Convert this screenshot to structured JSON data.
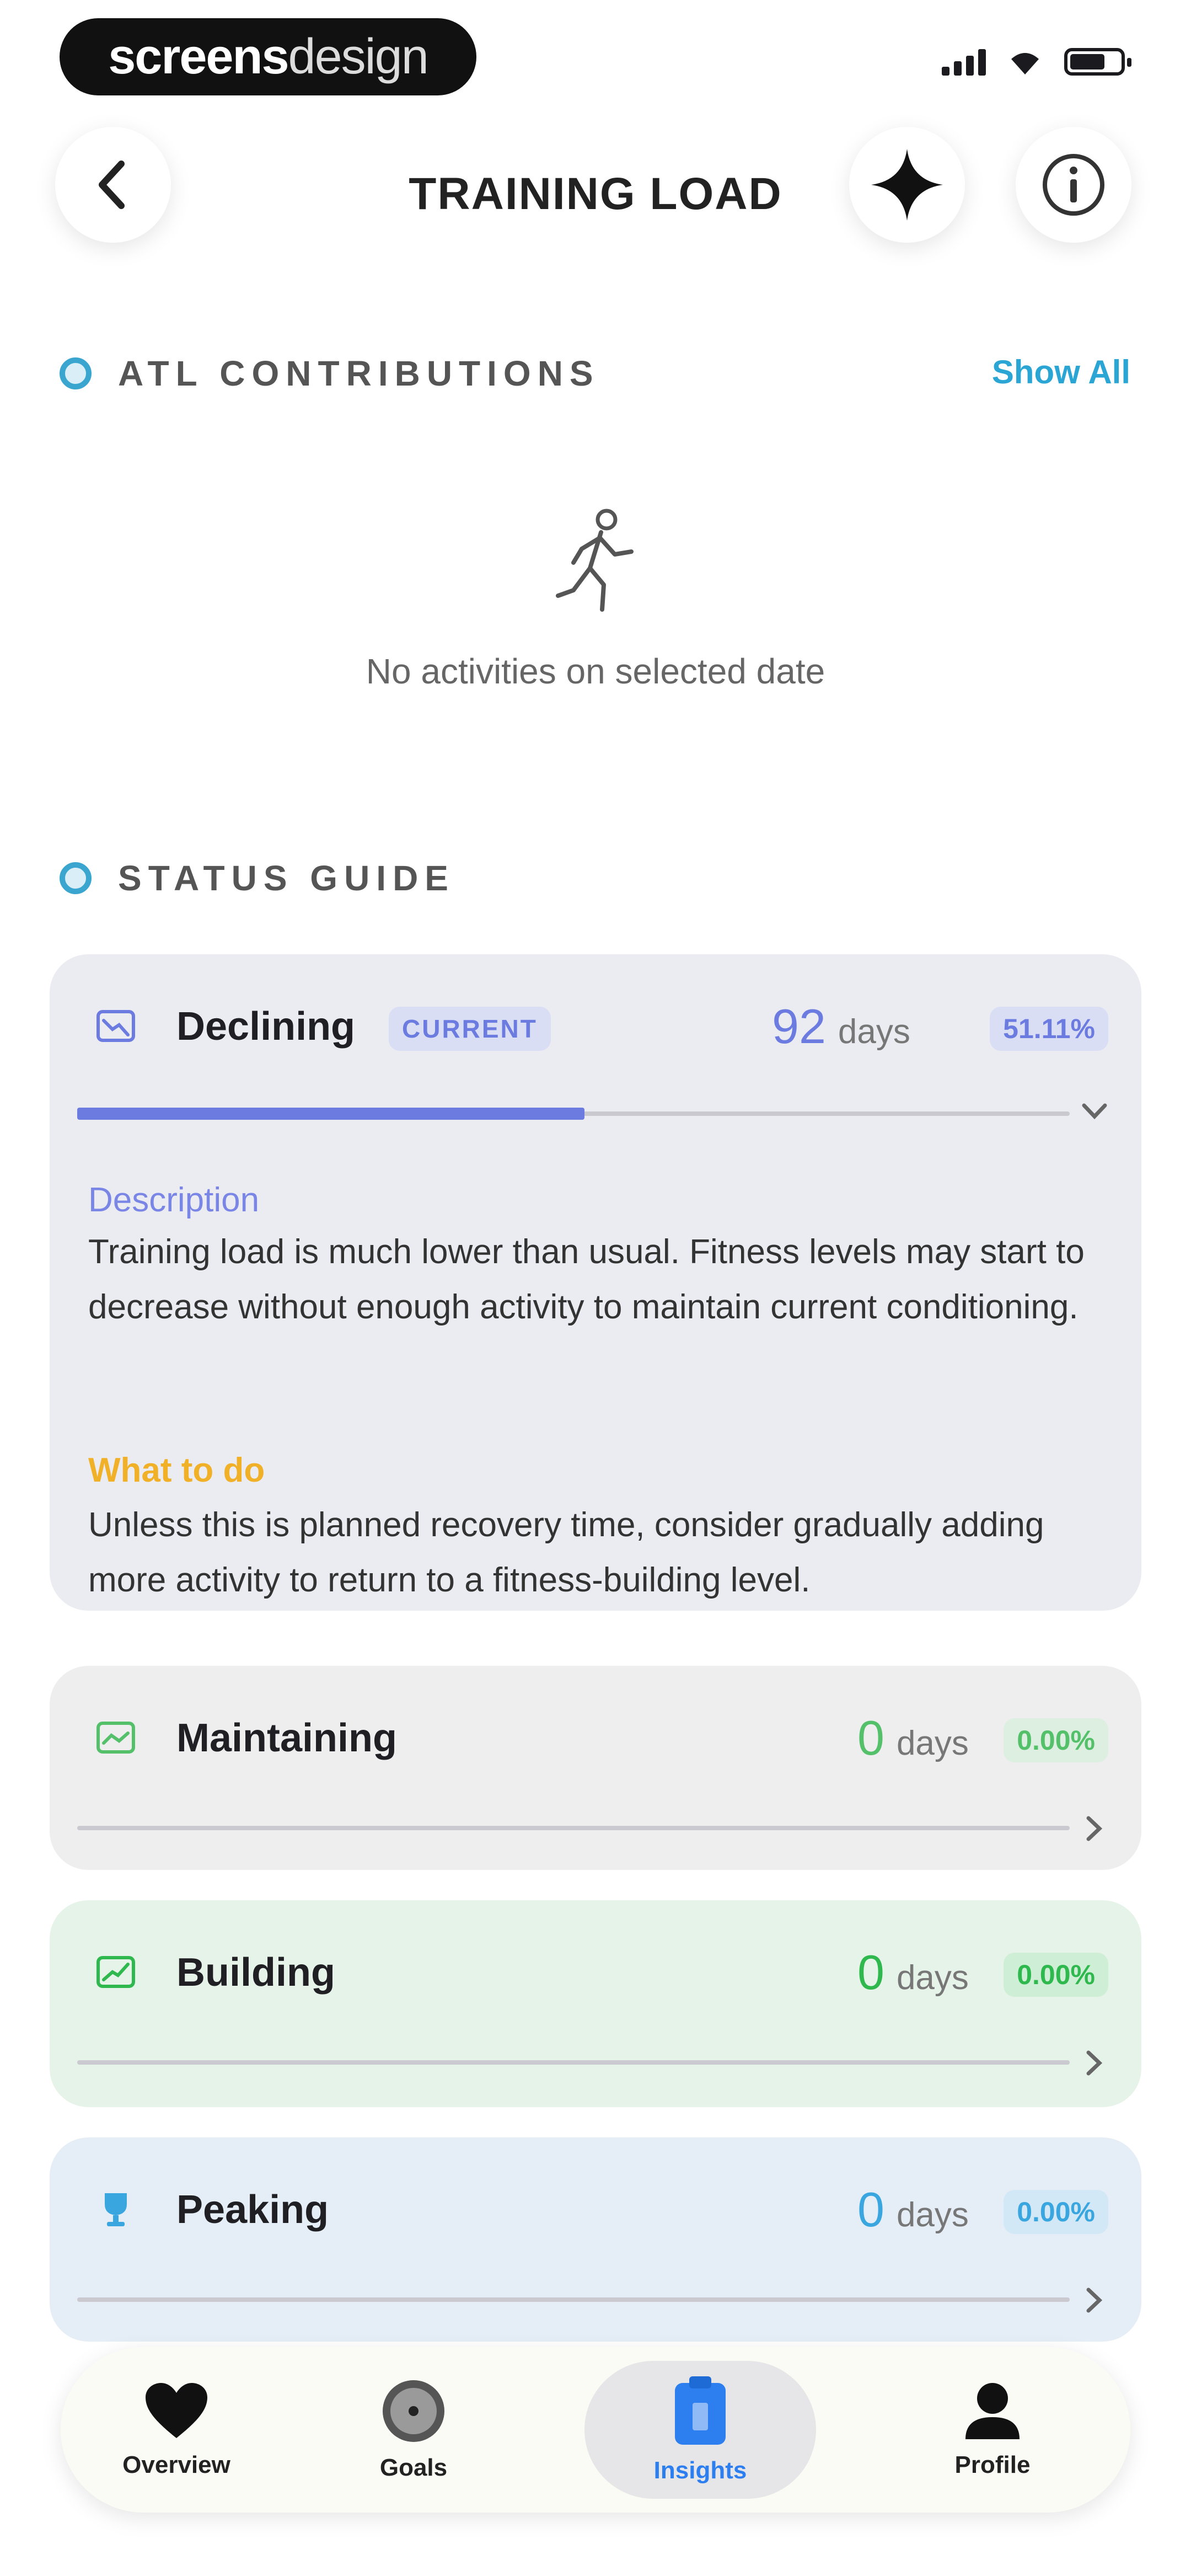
{
  "status_bar": {
    "brand_main": "screens",
    "brand_sub": "design"
  },
  "header": {
    "title": "TRAINING LOAD"
  },
  "atl": {
    "section_label": "ATL CONTRIBUTIONS",
    "show_all": "Show All",
    "empty_text": "No activities on selected date"
  },
  "status_guide": {
    "section_label": "STATUS GUIDE",
    "cards": [
      {
        "name": "Declining",
        "badge": "CURRENT",
        "days": "92",
        "days_unit": "days",
        "percent": "51.11%",
        "progress_percent": 51.11,
        "color": "#6b7be0",
        "description_label": "Description",
        "description": "Training load is much lower than usual. Fitness levels may start to decrease without enough activity to maintain current conditioning.",
        "todo_label": "What to do",
        "todo": "Unless this is planned recovery time, consider gradually adding more activity to return to a fitness-building level."
      },
      {
        "name": "Maintaining",
        "days": "0",
        "days_unit": "days",
        "percent": "0.00%",
        "progress_percent": 0,
        "color": "#55c06a"
      },
      {
        "name": "Building",
        "days": "0",
        "days_unit": "days",
        "percent": "0.00%",
        "progress_percent": 0,
        "color": "#2fb84e"
      },
      {
        "name": "Peaking",
        "days": "0",
        "days_unit": "days",
        "percent": "0.00%",
        "progress_percent": 0,
        "color": "#3aa6e0"
      }
    ]
  },
  "nav": {
    "items": [
      {
        "label": "Overview",
        "icon": "heart-icon"
      },
      {
        "label": "Goals",
        "icon": "target-icon"
      },
      {
        "label": "Insights",
        "icon": "clipboard-icon",
        "active": true
      },
      {
        "label": "Profile",
        "icon": "person-icon"
      }
    ]
  },
  "colors": {
    "accent": "#2ba6d4",
    "active_nav": "#2d7ff0",
    "warning": "#f0b129"
  }
}
